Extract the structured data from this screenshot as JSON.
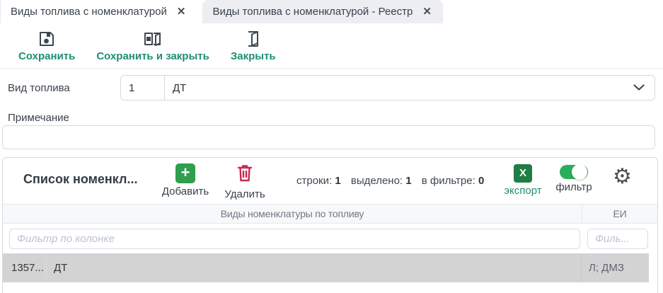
{
  "tabs": [
    {
      "label": "Виды топлива с номенклатурой",
      "active": true
    },
    {
      "label": "Виды топлива с номенклатурой - Реестр",
      "active": false
    }
  ],
  "toolbar": {
    "save": "Сохранить",
    "save_close": "Сохранить и закрыть",
    "close": "Закрыть"
  },
  "form": {
    "fuel_type_label": "Вид топлива",
    "fuel_type_code": "1",
    "fuel_type_name": "ДТ",
    "note_label": "Примечание",
    "note_value": ""
  },
  "panel": {
    "title": "Список номенкл...",
    "add_label": "Добавить",
    "delete_label": "Удалить",
    "rows_label": "строки:",
    "rows_value": "1",
    "selected_label": "выделено:",
    "selected_value": "1",
    "in_filter_label": "в фильтре:",
    "in_filter_value": "0",
    "export_label": "экспорт",
    "filter_label": "фильтр"
  },
  "table": {
    "col_main_header": "Виды номенклатуры по топливу",
    "col_unit_header": "ЕИ",
    "filter_main_placeholder": "Фильтр по колонке",
    "filter_unit_placeholder": "Филь...",
    "rows": [
      {
        "id": "1357...",
        "name": "ДТ",
        "unit": "Л; ДМЗ"
      }
    ]
  },
  "accent_colors": {
    "teal_link": "#1e8f72",
    "add_green": "#2f9e4e",
    "excel_green": "#1e7e45",
    "toggle_green": "#2bae5c",
    "delete_red": "#c92a52",
    "selected_row": "#d3d3d4"
  }
}
